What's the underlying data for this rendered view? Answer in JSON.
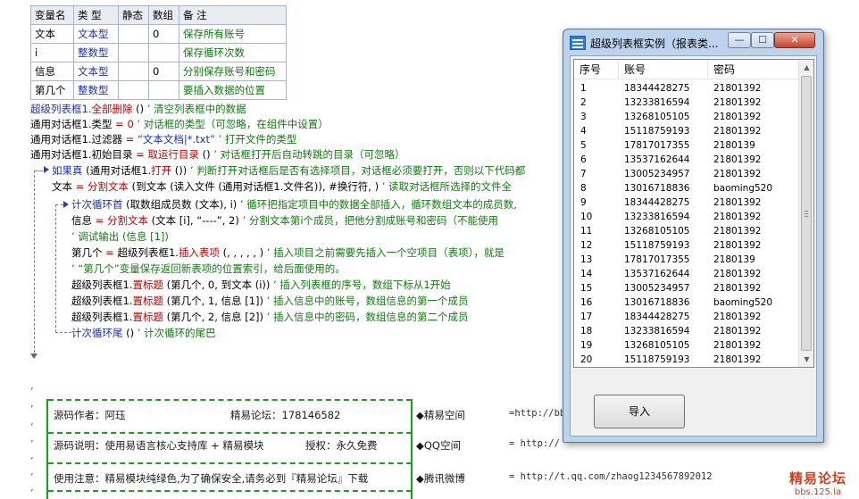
{
  "var_table": {
    "headers": [
      "变量名",
      "类 型",
      "静态",
      "数组",
      "备 注"
    ],
    "rows": [
      [
        "文本",
        "文本型",
        "",
        "0",
        "保存所有账号"
      ],
      [
        "i",
        "整数型",
        "",
        "",
        "保存循环次数"
      ],
      [
        "信息",
        "文本型",
        "",
        "0",
        "分别保存账号和密码"
      ],
      [
        "第几个",
        "整数型",
        "",
        "",
        "要插入数据的位置"
      ]
    ]
  },
  "code": {
    "l1": [
      "超级列表框1.",
      "全部删除",
      " () ",
      " ’ 清空列表框中的数据"
    ],
    "l2": [
      "通用对话框1.类型",
      " = ",
      "0",
      " ’ 对话框的类型（可忽略，在组件中设置）"
    ],
    "l3": [
      "通用对话框1.过滤器",
      " = ",
      "“文本文档|*.txt”",
      "  ’ 打开文件的类型"
    ],
    "l4": [
      "通用对话框1.初始目录",
      " = ",
      "取运行目录",
      " () ",
      " ’ 对话框打开后自动转跳的目录（可忽略）"
    ],
    "l5": [
      "如果真",
      " (通用对话框1.",
      "打开",
      " ())",
      "  ’ 判断打开对话框后是否有选择项目，对话框必须要打开，否则以下代码都"
    ],
    "l6": [
      "文本",
      " = ",
      "分割文本",
      " (到文本 (读入文件 (通用对话框1.文件名)), #换行符, )",
      "  ’ 读取对话框所选择的文件全"
    ],
    "l7": [
      "计次循环首",
      " (取数组成员数 (文本), i) ",
      " ’ 循环把指定项目中的数据全部插入，循环数组文本的成员数,"
    ],
    "l8": [
      "信息",
      " = ",
      "分割文本",
      " (文本 [i], “----”, 2)",
      "  ’ 分割文本第i个成员，把他分割成账号和密码（不能使用"
    ],
    "l9": [
      "’ 调试输出 (信息 [1])"
    ],
    "l10": [
      "第几个",
      " = ",
      "超级列表框1.",
      "插入表项",
      " (, , , , , )",
      "  ’ 插入项目之前需要先插入一个空项目（表项），就是"
    ],
    "l11": [
      "’ “第几个”变量保存返回新表项的位置索引，给后面使用的。"
    ],
    "l12": [
      "超级列表框1.",
      "置标题",
      " (第几个, 0, 到文本 (i))",
      "  ’ 插入列表框的序号，数组下标从1开始"
    ],
    "l13": [
      "超级列表框1.",
      "置标题",
      " (第几个, 1, 信息 [1])",
      "  ’ 插入信息中的账号，数组信息的第一个成员"
    ],
    "l14": [
      "超级列表框1.",
      "置标题",
      " (第几个, 2, 信息 [2])",
      "  ’ 插入信息中的密码，数组信息的第二个成员"
    ],
    "l15": [
      "计次循环尾",
      " () ",
      " ’ 计次循环的尾巴"
    ]
  },
  "footer_box": {
    "row1_left": "源码作者：阿珏",
    "row1_mid": "精易论坛：178146582",
    "row1_right_label": "◆精易空间",
    "row1_right_url": "=http://bb",
    "row2_left": "源码说明：使用易语言核心支持库 + 精易模块",
    "row2_mid": "授权：永久免费",
    "row2_right_label": "◆QQ空间",
    "row2_right_url": "= http://",
    "row3_left": "使用注意：精易模块纯绿色,为了确保安全,请务必到『精易论坛』下载",
    "row3_right_label": "◆腾讯微博",
    "row3_right_url": "= http://t.qq.com/zhaog1234567892012"
  },
  "watermark": {
    "line1": "精易论坛",
    "line2": "bbs.125.la"
  },
  "window": {
    "title": "超级列表框实例（报表类...",
    "btn_min": "—",
    "btn_max": "☐",
    "btn_close": "✕",
    "columns": [
      "序号",
      "账号",
      "密码"
    ],
    "rows": [
      [
        "1",
        "18344428275",
        "21801392"
      ],
      [
        "2",
        "13233816594",
        "21801392"
      ],
      [
        "3",
        "13268105105",
        "21801392"
      ],
      [
        "4",
        "15118759193",
        "21801392"
      ],
      [
        "5",
        "17817017355",
        "2180139"
      ],
      [
        "6",
        "13537162644",
        "21801392"
      ],
      [
        "7",
        "13005234957",
        "21801392"
      ],
      [
        "8",
        "13016718836",
        "baoming520"
      ],
      [
        "9",
        "18344428275",
        "21801392"
      ],
      [
        "10",
        "13233816594",
        "21801392"
      ],
      [
        "11",
        "13268105105",
        "21801392"
      ],
      [
        "12",
        "15118759193",
        "21801392"
      ],
      [
        "13",
        "17817017355",
        "2180139"
      ],
      [
        "14",
        "13537162644",
        "21801392"
      ],
      [
        "15",
        "13005234957",
        "21801392"
      ],
      [
        "16",
        "13016718836",
        "baoming520"
      ],
      [
        "17",
        "18344428275",
        "21801392"
      ],
      [
        "18",
        "13233816594",
        "21801392"
      ],
      [
        "19",
        "13268105105",
        "21801392"
      ],
      [
        "20",
        "15118759193",
        "21801392"
      ]
    ],
    "import_button": "导入"
  }
}
